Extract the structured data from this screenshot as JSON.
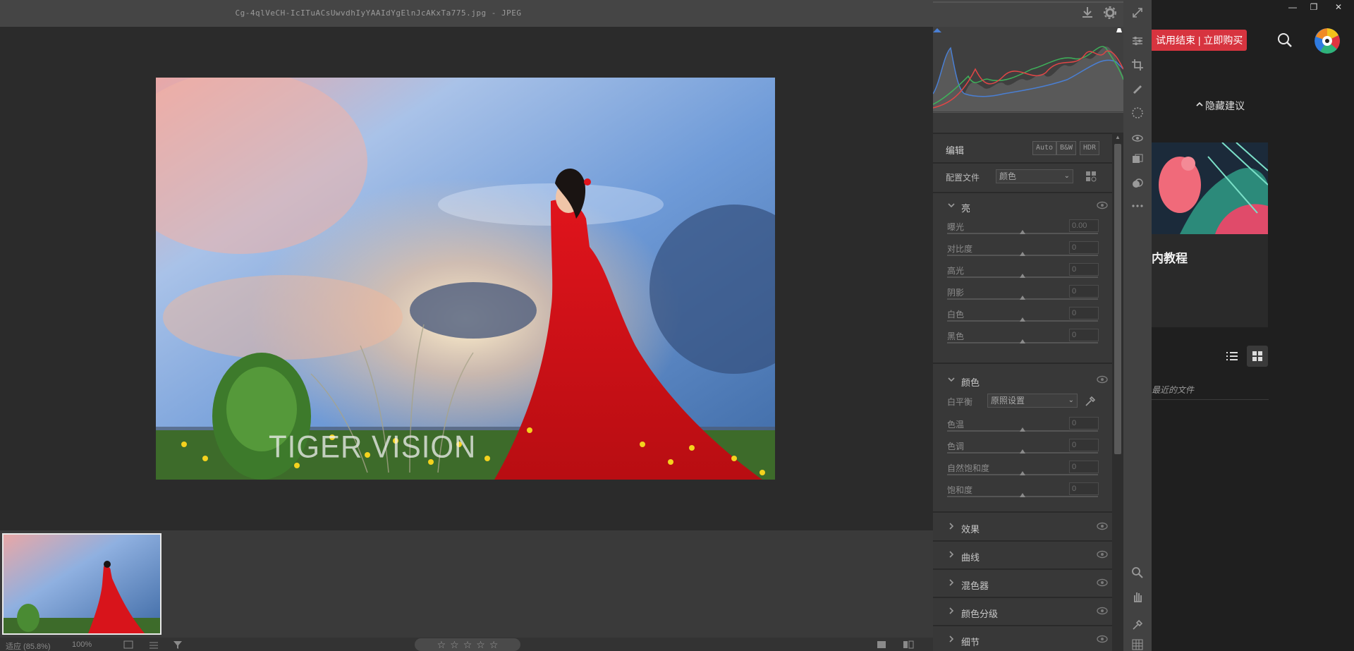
{
  "window": {
    "filename": "Cg-4qlVeCH-IcITuACsUwvdhIyYAAIdYgElnJcAKxTa775.jpg",
    "format": "JPEG"
  },
  "photo": {
    "watermark": "TIGER VISION"
  },
  "statusbar": {
    "zoom_fit": "适应 (85.8%)",
    "zoom_100": "100%",
    "stars": [
      "☆",
      "☆",
      "☆",
      "☆",
      "☆"
    ]
  },
  "edit": {
    "header": "编辑",
    "auto": "Auto",
    "bw": "B&W",
    "hdr": "HDR",
    "profile_label": "配置文件",
    "profile_value": "颜色"
  },
  "light": {
    "title": "亮",
    "sliders": [
      {
        "name": "曝光",
        "value": "0.00"
      },
      {
        "name": "对比度",
        "value": "0"
      },
      {
        "name": "高光",
        "value": "0"
      },
      {
        "name": "阴影",
        "value": "0"
      },
      {
        "name": "白色",
        "value": "0"
      },
      {
        "name": "黑色",
        "value": "0"
      }
    ]
  },
  "color": {
    "title": "颜色",
    "wb_label": "白平衡",
    "wb_value": "原照设置",
    "sliders": [
      {
        "name": "色温",
        "value": "0"
      },
      {
        "name": "色调",
        "value": "0"
      },
      {
        "name": "自然饱和度",
        "value": "0"
      },
      {
        "name": "饱和度",
        "value": "0"
      }
    ]
  },
  "collapsed_sections": [
    "效果",
    "曲线",
    "混色器",
    "颜色分级",
    "细节"
  ],
  "bgapp": {
    "trial_text": "试用结束 | 立即购买",
    "hide_suggestions": "隐藏建议",
    "card_title": "内教程",
    "recent_text": "最近的文件"
  },
  "colors": {
    "accent_red": "#d7343f",
    "panel_bg": "#383838",
    "stage_bg": "#2b2b2b"
  }
}
